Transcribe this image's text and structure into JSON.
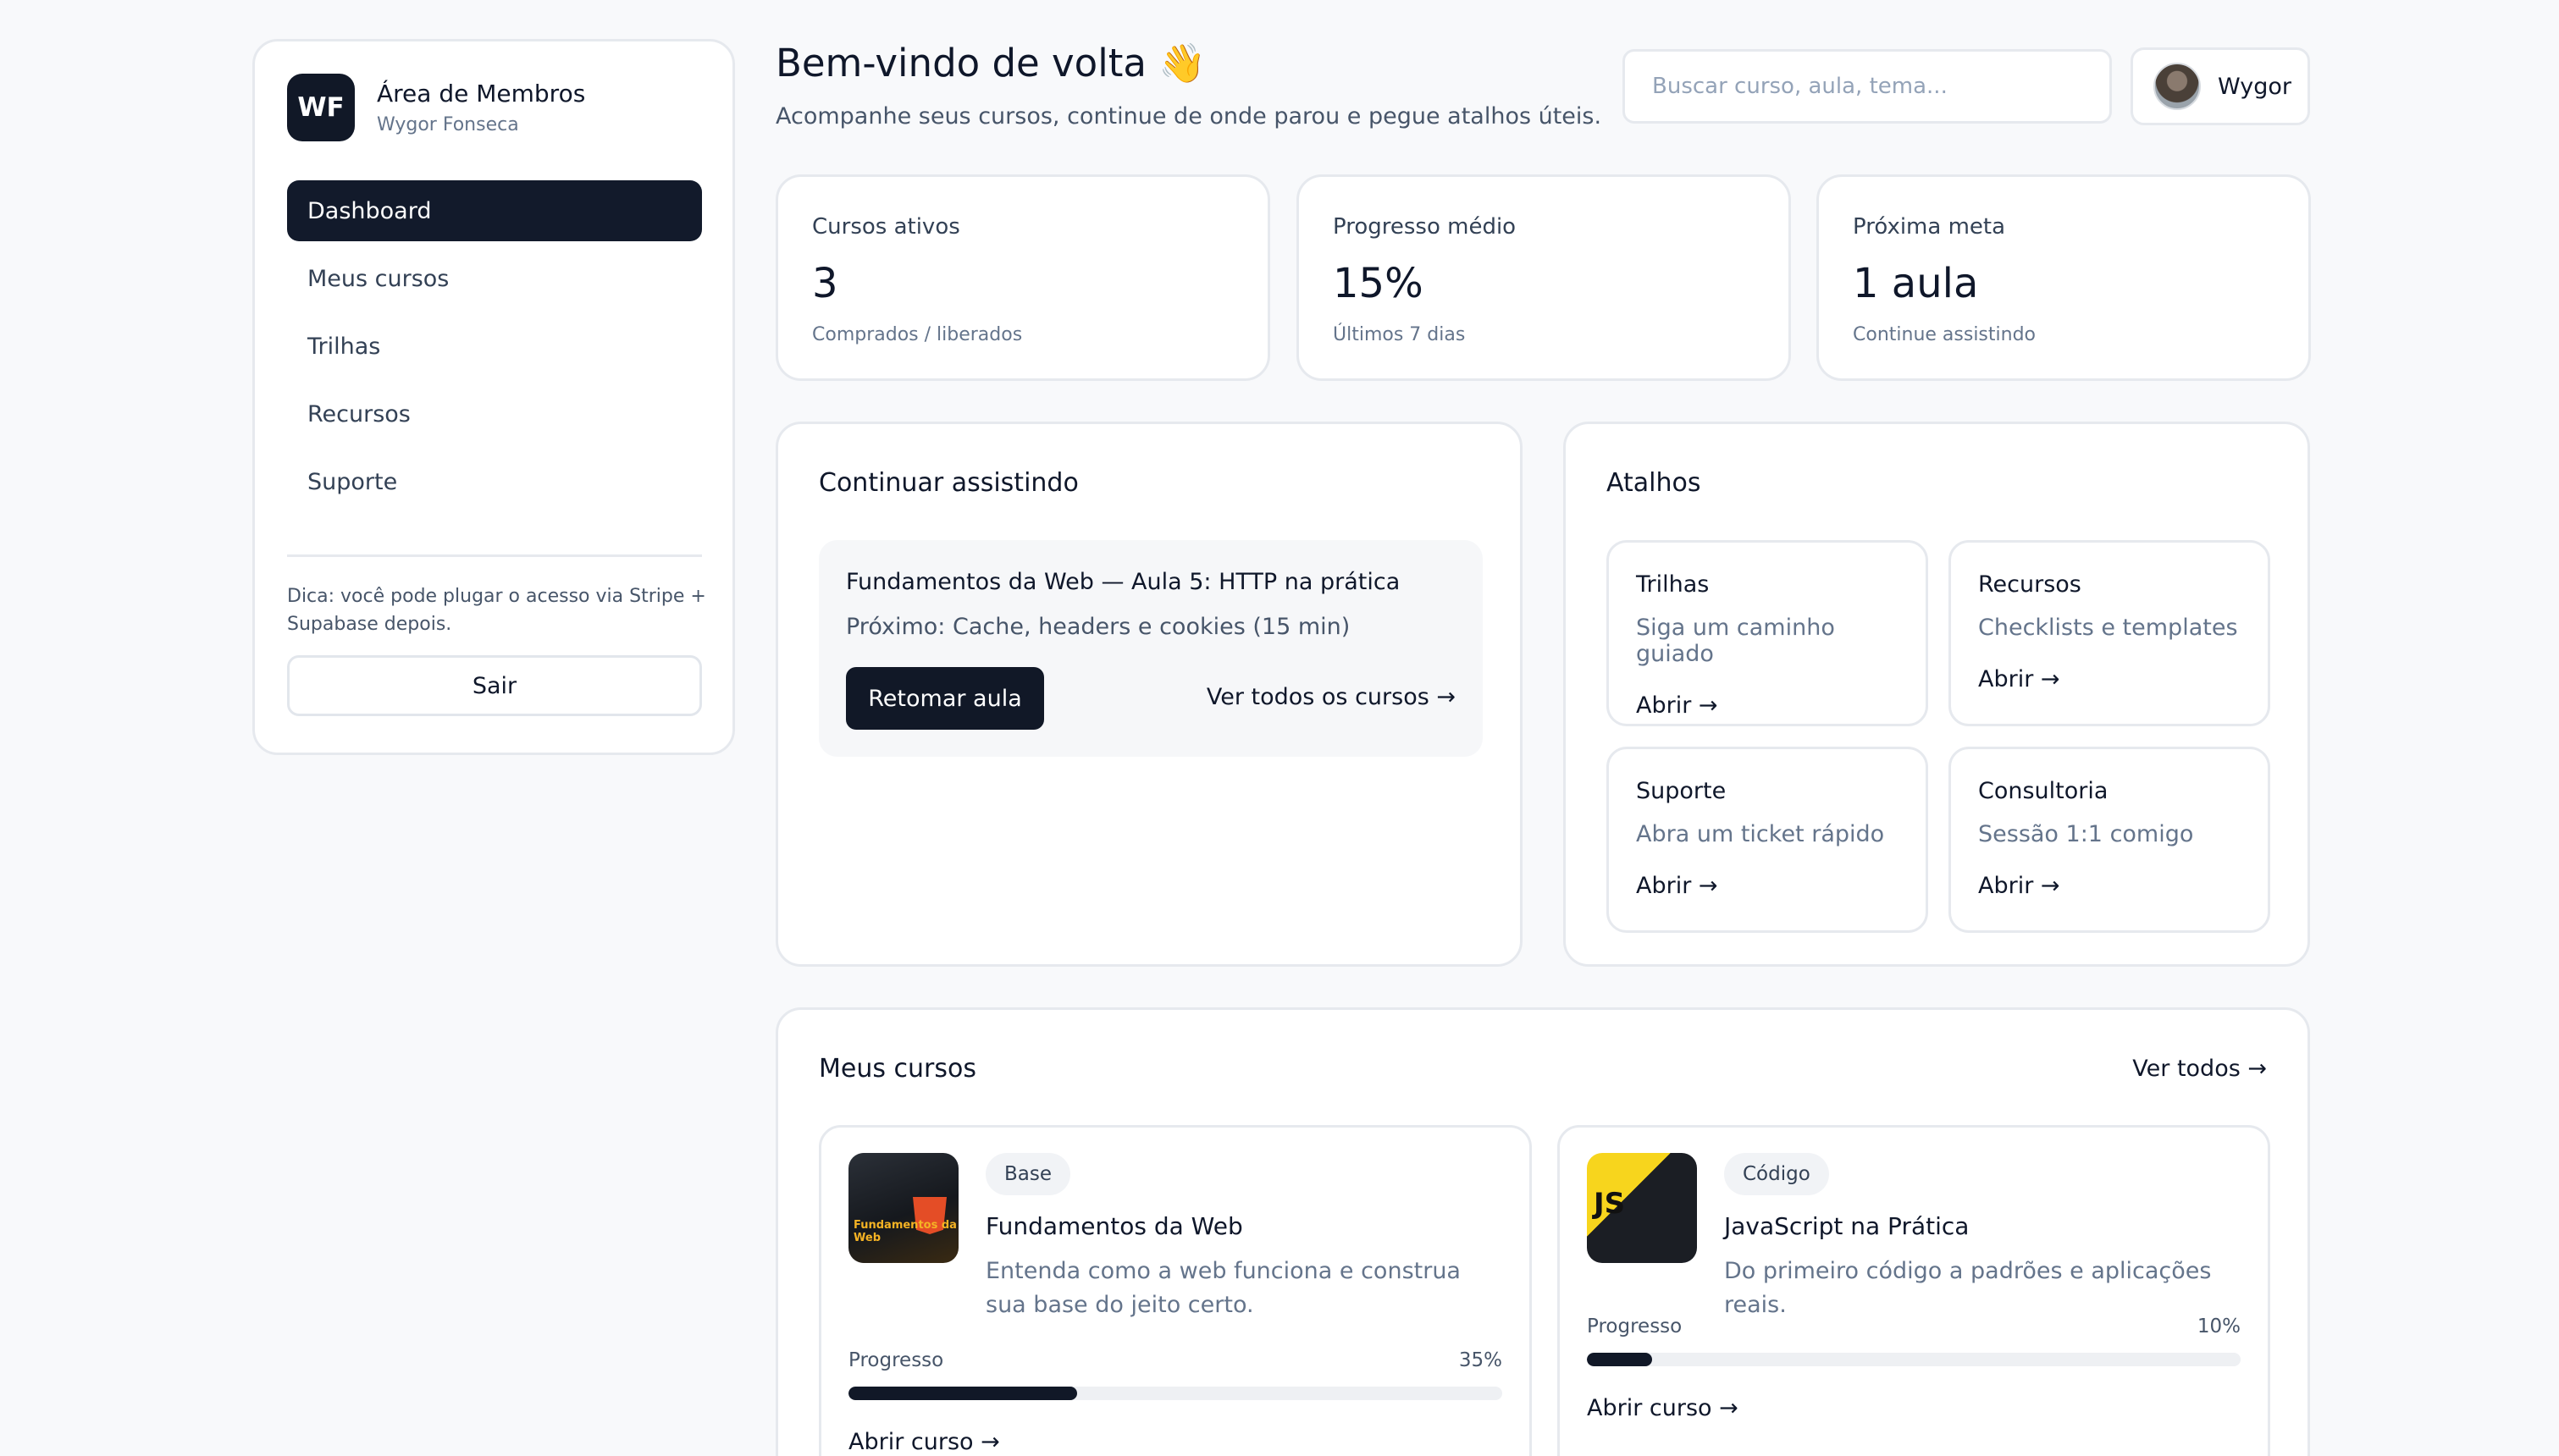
{
  "sidebar": {
    "logo": "WF",
    "title": "Área de Membros",
    "user": "Wygor Fonseca",
    "items": [
      {
        "label": "Dashboard"
      },
      {
        "label": "Meus cursos"
      },
      {
        "label": "Trilhas"
      },
      {
        "label": "Recursos"
      },
      {
        "label": "Suporte"
      }
    ],
    "tip": "Dica: você pode plugar o acesso via Stripe + Supabase depois.",
    "logout": "Sair"
  },
  "header": {
    "title": "Bem-vindo de volta 👋",
    "subtitle": "Acompanhe seus cursos, continue de onde parou e pegue atalhos úteis.",
    "search_placeholder": "Buscar curso, aula, tema...",
    "user_name": "Wygor"
  },
  "stats": [
    {
      "label": "Cursos ativos",
      "value": "3",
      "note": "Comprados / liberados"
    },
    {
      "label": "Progresso médio",
      "value": "15%",
      "note": "Últimos 7 dias"
    },
    {
      "label": "Próxima meta",
      "value": "1 aula",
      "note": "Continue assistindo"
    }
  ],
  "continue": {
    "title": "Continuar assistindo",
    "lesson": "Fundamentos da Web — Aula 5: HTTP na prática",
    "next": "Próximo: Cache, headers e cookies (15 min)",
    "resume": "Retomar aula",
    "all_courses": "Ver todos os cursos →"
  },
  "shortcuts": {
    "title": "Atalhos",
    "items": [
      {
        "title": "Trilhas",
        "desc": "Siga um caminho guiado",
        "link": "Abrir →"
      },
      {
        "title": "Recursos",
        "desc": "Checklists e templates",
        "link": "Abrir →"
      },
      {
        "title": "Suporte",
        "desc": "Abra um ticket rápido",
        "link": "Abrir →"
      },
      {
        "title": "Consultoria",
        "desc": "Sessão 1:1 comigo",
        "link": "Abrir →"
      }
    ]
  },
  "courses": {
    "title": "Meus cursos",
    "see_all": "Ver todos →",
    "items": [
      {
        "badge": "Base",
        "title": "Fundamentos da Web",
        "desc": "Entenda como a web funciona e construa sua base do jeito certo.",
        "progress_label": "Progresso",
        "progress": "35%",
        "progress_value": 0.35,
        "open": "Abrir curso →",
        "thumb_text": "Fundamentos da Web"
      },
      {
        "badge": "Código",
        "title": "JavaScript na Prática",
        "desc": "Do primeiro código a padrões e aplicações reais.",
        "progress_label": "Progresso",
        "progress": "10%",
        "progress_value": 0.1,
        "open": "Abrir curso →",
        "thumb_text": "JS"
      }
    ]
  }
}
